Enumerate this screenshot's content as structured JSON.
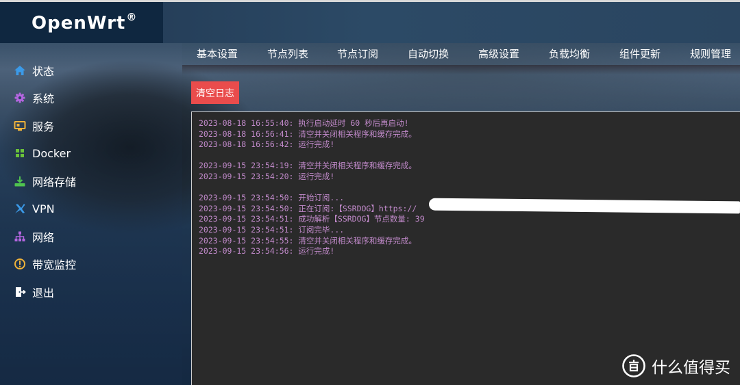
{
  "app": {
    "logo": "OpenWrt",
    "logo_mark": "®"
  },
  "sidebar": {
    "items": [
      {
        "label": "状态",
        "icon": "home-icon",
        "color": "#3b9ae8"
      },
      {
        "label": "系统",
        "icon": "gear-icon",
        "color": "#b466e0"
      },
      {
        "label": "服务",
        "icon": "services-icon",
        "color": "#f0b33a"
      },
      {
        "label": "Docker",
        "icon": "docker-icon",
        "color": "#6ac23a"
      },
      {
        "label": "网络存储",
        "icon": "storage-icon",
        "color": "#4fc44f"
      },
      {
        "label": "VPN",
        "icon": "vpn-icon",
        "color": "#3b9ae8"
      },
      {
        "label": "网络",
        "icon": "network-icon",
        "color": "#b466e0"
      },
      {
        "label": "带宽监控",
        "icon": "monitor-icon",
        "color": "#f0b33a"
      },
      {
        "label": "退出",
        "icon": "logout-icon",
        "color": "#ffffff"
      }
    ]
  },
  "tabs": [
    {
      "label": "基本设置"
    },
    {
      "label": "节点列表"
    },
    {
      "label": "节点订阅"
    },
    {
      "label": "自动切换"
    },
    {
      "label": "高级设置"
    },
    {
      "label": "负载均衡"
    },
    {
      "label": "组件更新"
    },
    {
      "label": "规则管理"
    }
  ],
  "actions": {
    "clear_log": "清空日志",
    "clear_log_color": "#e94c4c"
  },
  "log": {
    "text_color": "#c38bcc",
    "lines": [
      "2023-08-18 16:55:40: 执行启动延时 60 秒后再启动!",
      "2023-08-18 16:56:41: 清空并关闭相关程序和缓存完成。",
      "2023-08-18 16:56:42: 运行完成!",
      "",
      "2023-09-15 23:54:19: 清空并关闭相关程序和缓存完成。",
      "2023-09-15 23:54:20: 运行完成!",
      "",
      "2023-09-15 23:54:50: 开始订阅...",
      "2023-09-15 23:54:50: 正在订阅:【SSRDOG】https://",
      "2023-09-15 23:54:51: 成功解析【SSRDOG】节点数量: 39",
      "2023-09-15 23:54:51: 订阅完毕...",
      "2023-09-15 23:54:55: 清空并关闭相关程序和缓存完成。",
      "2023-09-15 23:54:56: 运行完成!"
    ]
  },
  "watermark": {
    "text": "什么值得买",
    "icon": "zhi-icon"
  }
}
